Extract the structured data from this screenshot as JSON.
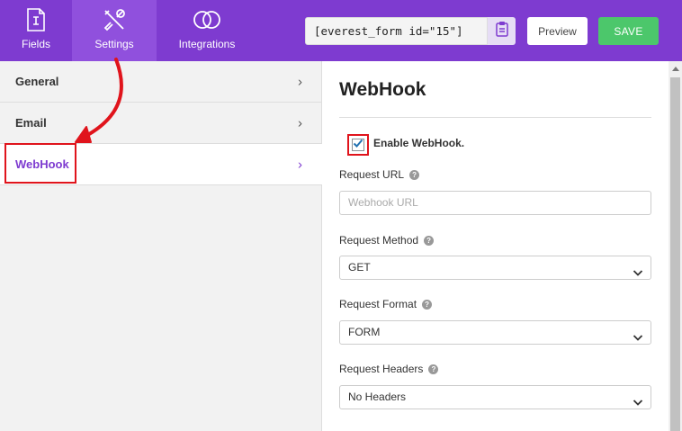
{
  "topbar": {
    "tabs": [
      {
        "label": "Fields",
        "icon": "fields-icon"
      },
      {
        "label": "Settings",
        "icon": "settings-tools-icon"
      },
      {
        "label": "Integrations",
        "icon": "integrations-rings-icon"
      }
    ],
    "shortcode": "[everest_form id=\"15\"]",
    "preview_label": "Preview",
    "save_label": "SAVE"
  },
  "sidebar": {
    "items": [
      {
        "label": "General"
      },
      {
        "label": "Email"
      },
      {
        "label": "WebHook",
        "active": true
      }
    ]
  },
  "main": {
    "title": "WebHook",
    "enable_label": "Enable WebHook.",
    "enable_checked": true,
    "request_url": {
      "label": "Request URL",
      "placeholder": "Webhook URL",
      "value": ""
    },
    "request_method": {
      "label": "Request Method",
      "value": "GET"
    },
    "request_format": {
      "label": "Request Format",
      "value": "FORM"
    },
    "request_headers": {
      "label": "Request Headers",
      "value": "No Headers"
    }
  },
  "colors": {
    "brand_purple": "#7e3bd0",
    "save_green": "#4cc76b",
    "annotation_red": "#e0141c"
  }
}
